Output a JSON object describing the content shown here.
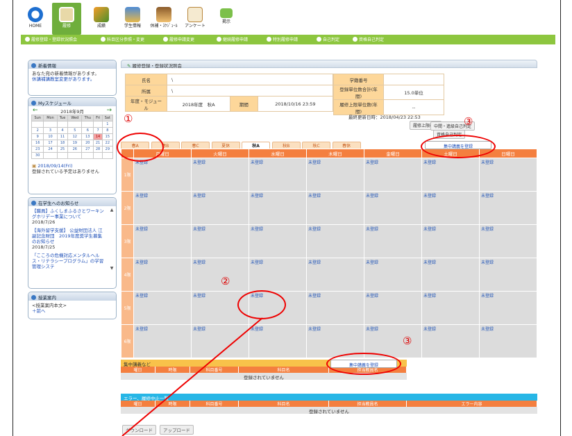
{
  "topnav": [
    {
      "label": "HOME",
      "icon": "home-icon",
      "active": false
    },
    {
      "label": "履修",
      "icon": "registration-icon",
      "active": true
    },
    {
      "label": "成績",
      "icon": "grades-icon",
      "active": false
    },
    {
      "label": "学生情報",
      "icon": "student-info-icon",
      "active": false
    },
    {
      "label": "休補・ｽｹｼﾞｭｰﾙ",
      "icon": "schedule-icon",
      "active": false
    },
    {
      "label": "アンケート",
      "icon": "survey-icon",
      "active": false
    },
    {
      "label": "掲示",
      "icon": "bulletin-icon",
      "active": false
    }
  ],
  "subnav": [
    "履修登録・登録状況照会",
    "科目区分参照・変更",
    "履修申請変更",
    "継続履修申請",
    "特別履修申請",
    "自己判定",
    "資格自己判定"
  ],
  "sidebar": {
    "news": {
      "title": "新着情報",
      "text": "あなた宛の新着情報があります。",
      "link": "休講補講教室変更があります。"
    },
    "schedule": {
      "title": "Myスケジュール",
      "month": "2018年9月",
      "dow": [
        "Sun",
        "Mon",
        "Tue",
        "Wed",
        "Thu",
        "Fri",
        "Sat"
      ],
      "weeks": [
        [
          "",
          "",
          "",
          "",
          "",
          "",
          "1"
        ],
        [
          "2",
          "3",
          "4",
          "5",
          "6",
          "7",
          "8"
        ],
        [
          "9",
          "10",
          "11",
          "12",
          "13",
          "14",
          "15"
        ],
        [
          "16",
          "17",
          "18",
          "19",
          "20",
          "21",
          "22"
        ],
        [
          "23",
          "24",
          "25",
          "26",
          "27",
          "28",
          "29"
        ],
        [
          "30",
          "",
          "",
          "",
          "",
          "",
          ""
        ]
      ],
      "today": "14",
      "date_link": "2018/09/14(Fri)",
      "empty": "登録されている予定はありません"
    },
    "notices": {
      "title": "在学生へのお知らせ",
      "items": [
        {
          "text": "【職員】ふくしまふるさとワーキングホリデー事業について",
          "date": "2018/7/26"
        },
        {
          "text": "【海外留学支援】 公益財団法人 江副記念財団　2019年度奨学生募集のお知らせ",
          "date": "2018/7/25"
        },
        {
          "text": "「こころの危機対応メンタルヘルス・リテラシープログラム」の学習管理システ",
          "date": ""
        }
      ]
    },
    "guide": {
      "title": "授業案内",
      "text": "<授業案内本文>",
      "nav": "＋前へ"
    }
  },
  "main": {
    "title": "履修登録・登録状況照会",
    "info": {
      "name_label": "氏名",
      "name_value": "\\",
      "dept_label": "所属",
      "dept_value": "\\",
      "year_label": "年度・モジュール",
      "year_value": "2018年度　秋A",
      "period_label": "期間",
      "period_value": "2018/10/16 23:59",
      "student_no_label": "学籍番号",
      "student_no_value": "",
      "units_label": "登録単位数合計(年間)",
      "units_value": "15.0単位",
      "limit_label": "履修上限単位数(年間)",
      "limit_value": "--",
      "limit_button": "履修上限確認",
      "updated": "最終更新日時：2018/04/23 22:53",
      "chuki_button": "中間・進級自己判定",
      "shikaku_button": "資格自己判定"
    },
    "tabs": [
      "春A",
      "春B",
      "春C",
      "夏休",
      "秋A",
      "秋B",
      "秋C",
      "春休"
    ],
    "active_tab": "秋A",
    "days": [
      "月曜日",
      "火曜日",
      "水曜日",
      "木曜日",
      "金曜日",
      "土曜日",
      "日曜日"
    ],
    "periods": [
      "1限",
      "2限",
      "3限",
      "4限",
      "5限",
      "6限"
    ],
    "cell_text": "未登録",
    "intensive_button": "集中講義を登録",
    "intensive": {
      "title": "集中講義など",
      "cols": [
        "曜日",
        "時限",
        "科目番号",
        "科目名",
        "担当教員名"
      ],
      "empty": "登録されていません"
    },
    "errors": {
      "title": "エラー、履修中止一覧",
      "cols": [
        "曜日",
        "時限",
        "科目番号",
        "科目名",
        "担当教員名",
        "エラー内容"
      ],
      "empty": "登録されていません"
    },
    "download": "ダウンロード",
    "upload": "アップロード"
  },
  "annotations": [
    "①",
    "②",
    "③",
    "③"
  ],
  "colors": {
    "header_orange": "#f47f3f",
    "label_bg": "#fdd79a",
    "green_nav": "#8dc63f",
    "annotation_red": "#e00000"
  }
}
